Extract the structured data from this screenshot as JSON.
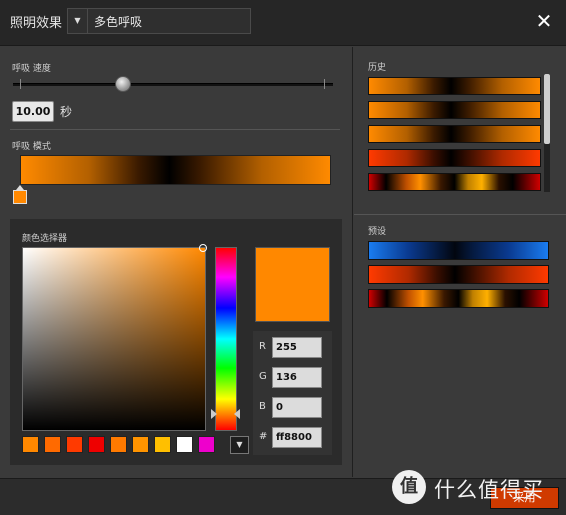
{
  "header": {
    "title": "照明效果",
    "mode_value": "多色呼吸",
    "mode_arrow": "▼",
    "close_glyph": "✕"
  },
  "speed": {
    "label": "呼吸 速度",
    "value": "10.00",
    "unit": "秒",
    "slider_fraction": 0.34
  },
  "pattern": {
    "label": "呼吸 模式"
  },
  "color_picker": {
    "label": "颜色选择器",
    "current_color": "#ff8800",
    "r_label": "R",
    "r_value": "255",
    "g_label": "G",
    "g_value": "136",
    "b_label": "B",
    "b_value": "0",
    "hex_label": "#",
    "hex_value": "ff8800",
    "swatches": [
      "#ff8800",
      "#ff6a00",
      "#ff3a00",
      "#ee0000",
      "#ff7a00",
      "#ff9400",
      "#ffbf00",
      "#ffffff",
      "#ee00cc"
    ],
    "more_glyph": "▼"
  },
  "history": {
    "label": "历史",
    "items": [
      "orange",
      "orange",
      "orange",
      "red",
      "fire"
    ]
  },
  "presets": {
    "label": "预设",
    "items": [
      "blue",
      "red",
      "fire"
    ]
  },
  "footer": {
    "apply_label": "采用"
  },
  "watermark": {
    "logo_glyph": "值",
    "text": "什么值得买"
  },
  "colors": {
    "accent": "#ff8800",
    "apply_button": "#d03a00"
  }
}
